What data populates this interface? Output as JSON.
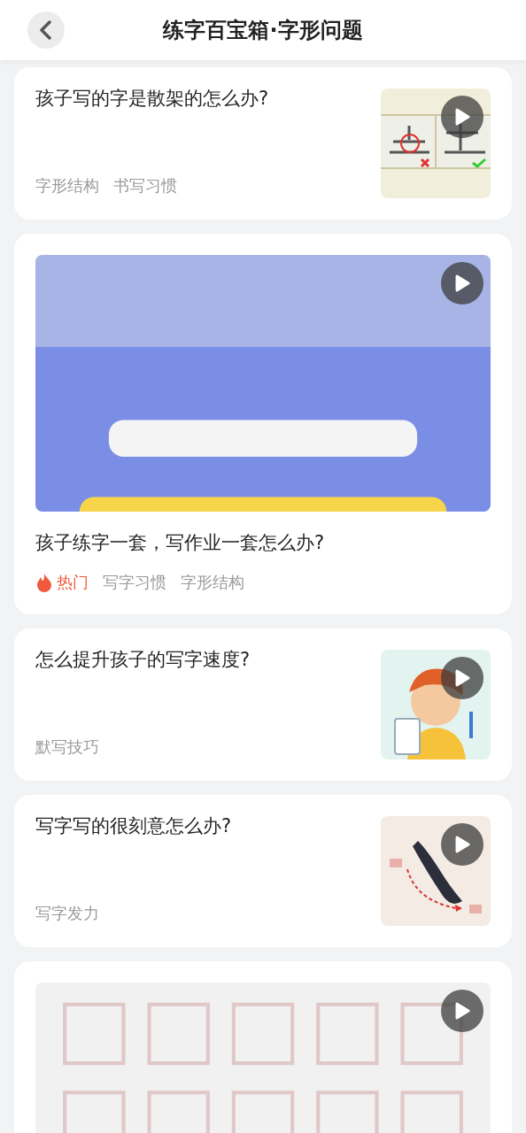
{
  "header": {
    "title": "练字百宝箱·字形问题"
  },
  "cards": [
    {
      "kind": "side",
      "title": "孩子写的字是散架的怎么办?",
      "thumbnail": {
        "kind": "picture"
      },
      "tags": [
        {
          "label": "字形结构",
          "kind": "plain"
        },
        {
          "label": "书写习惯",
          "kind": "plain"
        }
      ]
    },
    {
      "kind": "top",
      "title": "孩子练字一套，写作业一套怎么办?",
      "thumbnail": {
        "kind": "picture"
      },
      "tags": [
        {
          "label": "热门",
          "kind": "hot"
        },
        {
          "label": "写字习惯",
          "kind": "plain"
        },
        {
          "label": "字形结构",
          "kind": "plain"
        }
      ]
    },
    {
      "kind": "side",
      "title": "怎么提升孩子的写字速度?",
      "thumbnail": {
        "kind": "picture"
      },
      "tags": [
        {
          "label": "默写技巧",
          "kind": "plain"
        }
      ]
    },
    {
      "kind": "side",
      "title": "写字写的很刻意怎么办?",
      "thumbnail": {
        "kind": "picture"
      },
      "tags": [
        {
          "label": "写字发力",
          "kind": "plain"
        }
      ]
    },
    {
      "kind": "top",
      "thumbnail": {
        "kind": "picture"
      }
    }
  ]
}
